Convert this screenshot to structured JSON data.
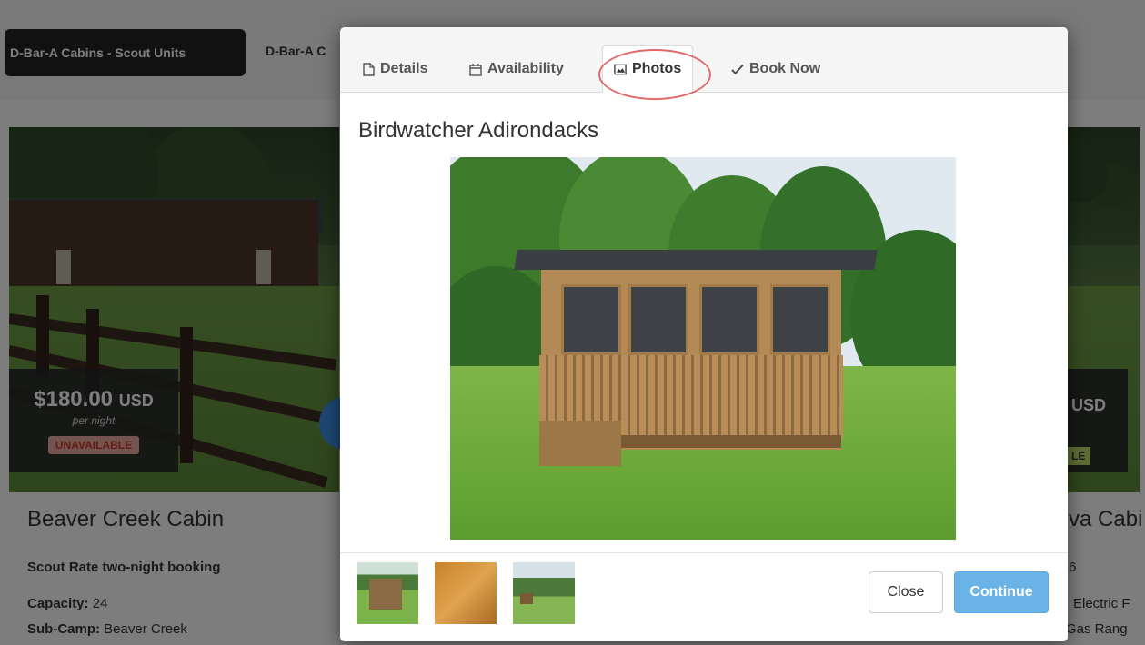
{
  "background": {
    "nav": {
      "active_tab": "D-Bar-A Cabins - Scout Units",
      "second_tab": "D-Bar-A C"
    },
    "left_card": {
      "price": "$180.00",
      "currency": "USD",
      "per_night": "per night",
      "status": "UNAVAILABLE",
      "title": "Beaver Creek Cabin",
      "rate": "Scout Rate two-night booking",
      "capacity_label": "Capacity:",
      "capacity_value": "24",
      "subcamp_label": "Sub-Camp:",
      "subcamp_value": "Beaver Creek"
    },
    "right_card": {
      "currency": "USD",
      "status_fragment": "LE",
      "title_fragment": "va Cabi",
      "line1": "6",
      "line2": "Electric F",
      "line3": "Gas Rang"
    }
  },
  "modal": {
    "tabs": [
      {
        "label": "Details",
        "icon": "document-icon"
      },
      {
        "label": "Availability",
        "icon": "calendar-icon"
      },
      {
        "label": "Photos",
        "icon": "image-icon",
        "active": true
      },
      {
        "label": "Book Now",
        "icon": "checkmark-icon"
      }
    ],
    "title": "Birdwatcher Adirondacks",
    "thumbnails": [
      "cabin exterior",
      "cabin interior",
      "cabin in field"
    ],
    "buttons": {
      "close": "Close",
      "continue": "Continue"
    }
  },
  "colors": {
    "accent": "#6ab3e6",
    "unavailable_badge": "#e8a9a0",
    "annotation": "#e26a6a"
  }
}
